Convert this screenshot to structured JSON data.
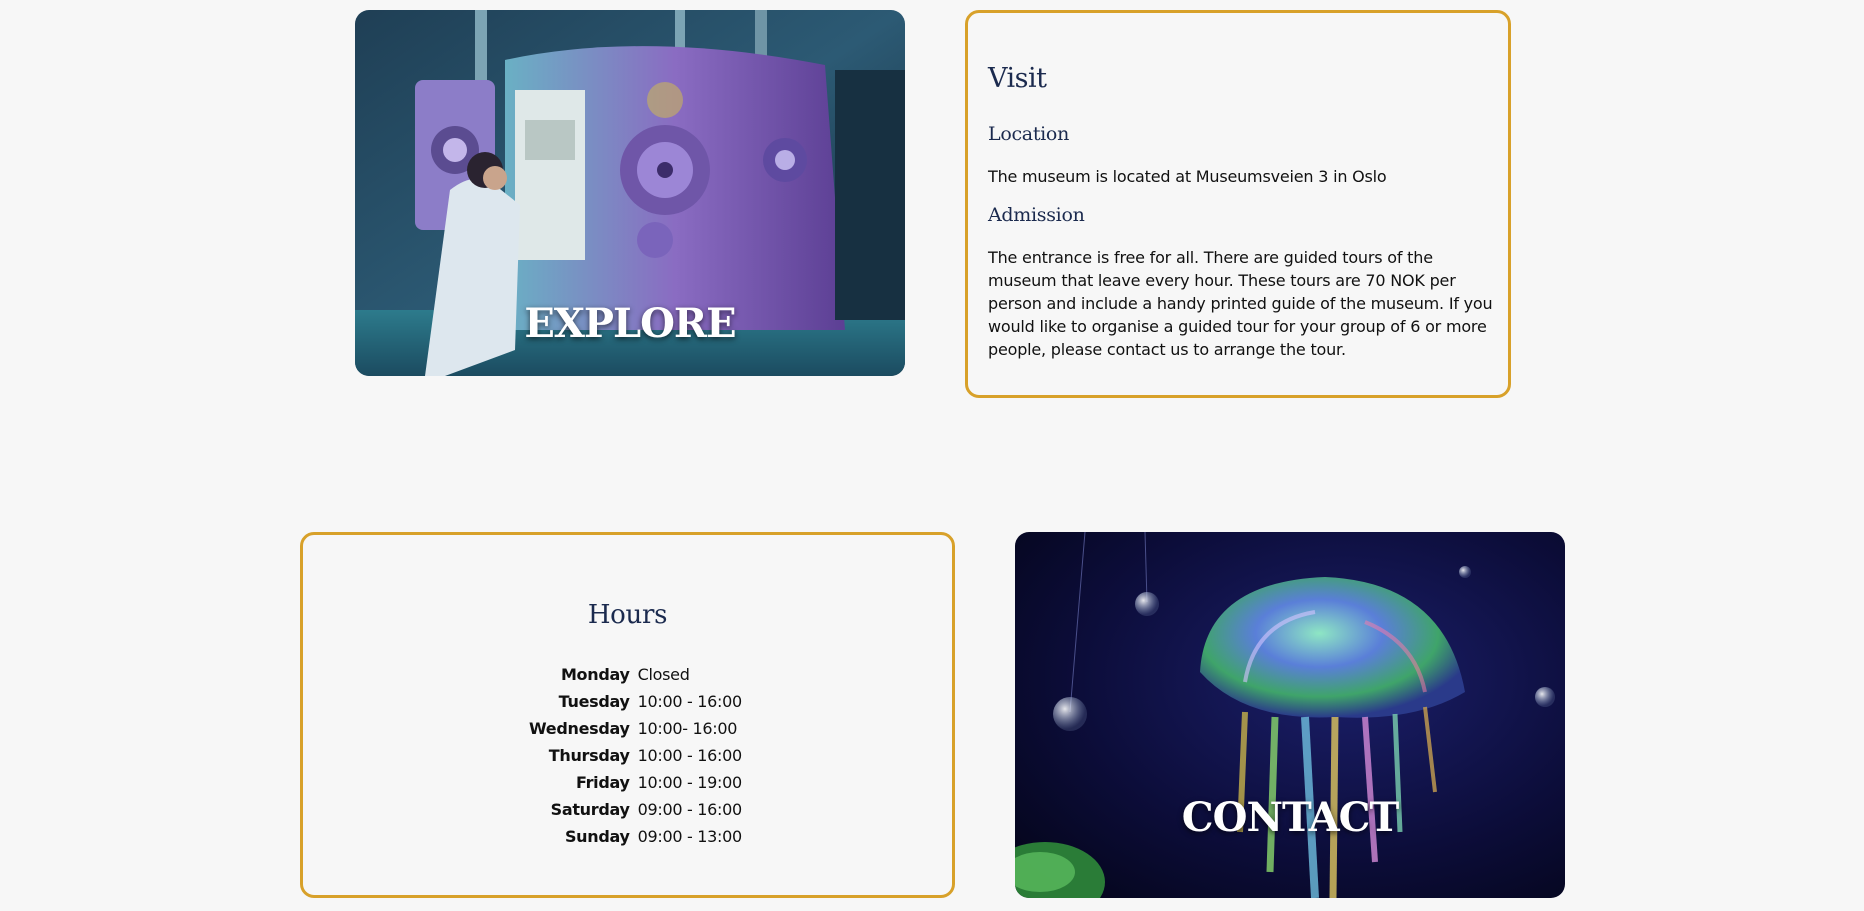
{
  "explore": {
    "label": "EXPLORE"
  },
  "visit": {
    "title": "Visit",
    "location_heading": "Location",
    "location_text": "The museum is located at Museumsveien 3 in Oslo",
    "admission_heading": "Admission",
    "admission_text": "The entrance is free for all. There are guided tours of the museum that leave every hour. These tours are 70 NOK per person and include a handy printed guide of the museum. If you would like to organise a guided tour for your group of 6 or more people, please contact us to arrange the tour."
  },
  "hours": {
    "title": "Hours",
    "rows": [
      {
        "day": "Monday",
        "time": "Closed"
      },
      {
        "day": "Tuesday",
        "time": "10:00 - 16:00"
      },
      {
        "day": "Wednesday",
        "time": "10:00- 16:00"
      },
      {
        "day": "Thursday",
        "time": "10:00 - 16:00"
      },
      {
        "day": "Friday",
        "time": "10:00 - 19:00"
      },
      {
        "day": "Saturday",
        "time": "09:00 - 16:00"
      },
      {
        "day": "Sunday",
        "time": "09:00 - 13:00"
      }
    ]
  },
  "contact": {
    "label": "CONTACT"
  },
  "colors": {
    "background": "#f7f7f7",
    "card_border": "#d8a12a",
    "heading": "#1b2a4e",
    "text": "#111111"
  }
}
